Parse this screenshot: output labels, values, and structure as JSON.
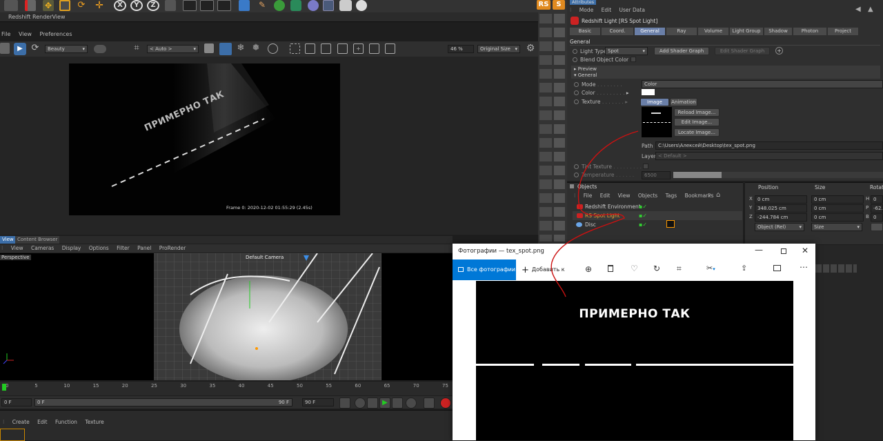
{
  "renderview": {
    "title": "Redshift RenderView",
    "menu": [
      "File",
      "View",
      "Preferences"
    ],
    "aov_select": "Beauty",
    "camera_select": "< Auto >",
    "zoom": "46 %",
    "size_select": "Original Size",
    "render_text": "ПРИМЕРНО ТАК",
    "frame_info": "Frame  0:  2020-12-02  01:55:29  (2.45s)"
  },
  "viewport": {
    "tabs": [
      "View",
      "Content Browser"
    ],
    "menu": [
      "View",
      "Cameras",
      "Display",
      "Options",
      "Filter",
      "Panel",
      "ProRender"
    ],
    "label": "Perspective",
    "camera_label": "Default Camera"
  },
  "timeline": {
    "ticks": [
      "0",
      "5",
      "10",
      "15",
      "20",
      "25",
      "30",
      "35",
      "40",
      "45",
      "50",
      "55",
      "60",
      "65",
      "70",
      "75"
    ],
    "current": "0 F",
    "start": "0 F",
    "end_field": "90 F",
    "end": "90 F"
  },
  "material_menu": [
    "Create",
    "Edit",
    "Function",
    "Texture"
  ],
  "attributes": {
    "panel_title": "Attributes",
    "menu": [
      "Mode",
      "Edit",
      "User Data"
    ],
    "object_title": "Redshift Light [RS Spot Light]",
    "tabs": [
      "Basic",
      "Coord.",
      "General",
      "Ray",
      "Volume",
      "Light Group",
      "Shadow",
      "Photon",
      "Project"
    ],
    "active_tab": "General",
    "section": "General",
    "light_type_label": "Light Type",
    "light_type_value": "Spot",
    "add_shader_graph": "Add Shader Graph",
    "edit_shader_graph": "Edit Shader Graph",
    "blend_label": "Blend Object Color",
    "preview_group": "Preview",
    "general_group": "General",
    "mode_label": "Mode",
    "mode_value": "Color",
    "color_label": "Color",
    "texture_label": "Texture",
    "texture_tabs": [
      "Image",
      "Animation"
    ],
    "reload_image": "Reload Image...",
    "edit_image": "Edit Image...",
    "locate_image": "Locate Image...",
    "path_label": "Path",
    "path_value": "C:\\Users\\Алексей\\Desktop\\tex_spot.png",
    "layer_label": "Layer",
    "layer_value": "< Default >",
    "tint_label": "Tint Texture",
    "temperature_label": "Temperature",
    "temperature_value": "6500"
  },
  "objects": {
    "title": "Objects",
    "menu": [
      "File",
      "Edit",
      "View",
      "Objects",
      "Tags",
      "Bookmarks"
    ],
    "items": [
      "Redshift Environment",
      "RS Spot Light",
      "Disc"
    ]
  },
  "coords": {
    "headers": [
      "Position",
      "Size",
      "Rotat"
    ],
    "x_pos": "0 cm",
    "y_pos": "348.025 cm",
    "z_pos": "-244.784 cm",
    "x_size": "0 cm",
    "y_size": "0 cm",
    "z_size": "0 cm",
    "h_rot": "0",
    "p_rot": "-62.",
    "b_rot": "0",
    "axis_x": "X",
    "axis_y": "Y",
    "axis_z": "Z",
    "rot_h": "H",
    "rot_p": "P",
    "rot_b": "B",
    "mode_select": "Object (Rel)",
    "size_select": "Size"
  },
  "photos": {
    "title": "Фотографии — tex_spot.png",
    "all_photos": "Все фотографии",
    "add_to": "Добавить к",
    "image_text": "ПРИМЕРНО ТАК"
  },
  "colors": {
    "accent": "#0078d7",
    "active_tab": "#6a7fa8",
    "selected_text": "#f0a030",
    "annotation": "#cc1111"
  }
}
